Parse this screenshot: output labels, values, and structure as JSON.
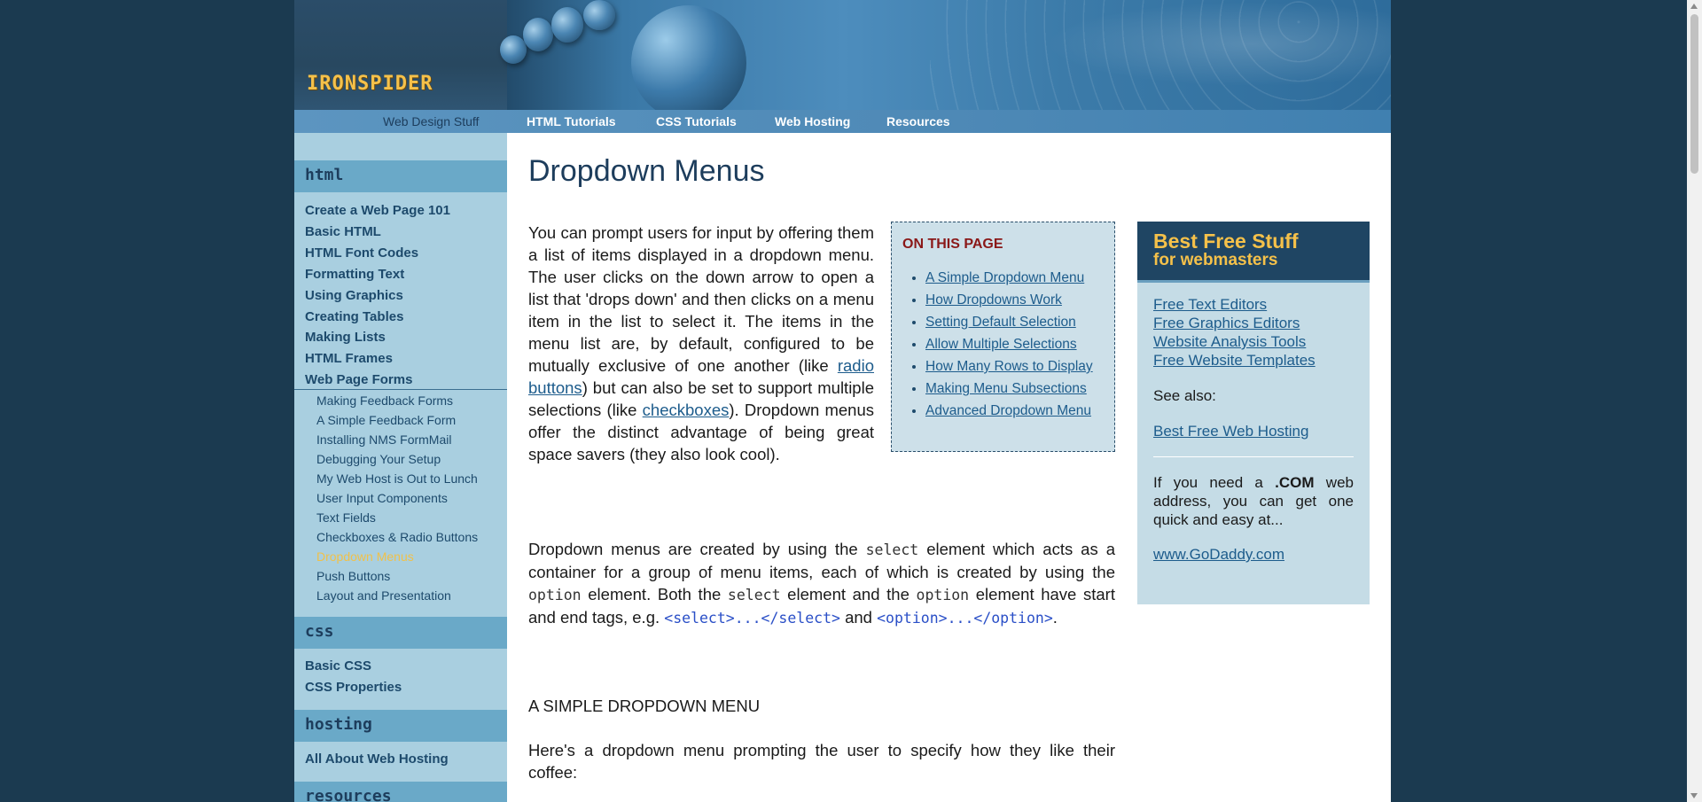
{
  "header": {
    "logo": "IRONSPIDER",
    "site_label": "Web Design Stuff",
    "nav": [
      "HTML Tutorials",
      "CSS Tutorials",
      "Web Hosting",
      "Resources"
    ]
  },
  "sidebar": {
    "sections": [
      {
        "heading": "html"
      },
      {
        "heading": "css"
      },
      {
        "heading": "hosting"
      },
      {
        "heading": "resources"
      }
    ],
    "html_links": [
      "Create a Web Page 101",
      "Basic HTML",
      "HTML Font Codes",
      "Formatting Text",
      "Using Graphics",
      "Creating Tables",
      "Making Lists",
      "HTML Frames",
      "Web Page Forms"
    ],
    "form_sublinks": [
      "Making Feedback Forms",
      "A Simple Feedback Form",
      "Installing NMS FormMail",
      "Debugging Your Setup",
      "My Web Host is Out to Lunch",
      "User Input Components",
      "Text Fields",
      "Checkboxes & Radio Buttons",
      "Dropdown Menus",
      "Push Buttons",
      "Layout and Presentation"
    ],
    "active_sublink": "Dropdown Menus",
    "css_links": [
      "Basic CSS",
      "CSS Properties"
    ],
    "hosting_links": [
      "All About Web Hosting"
    ]
  },
  "main": {
    "title": "Dropdown Menus",
    "intro_1": "You can prompt users for input by offering them a list of items displayed in a dropdown menu. The user clicks on the down arrow to open a list that 'drops down' and then clicks on a menu item in the list to select it. The items in the menu list are, by default, configured to be mutually exclusive of one another (like ",
    "intro_link_1": "radio buttons",
    "intro_2": ") but can also be set to support multiple selections (like ",
    "intro_link_2": "checkboxes",
    "intro_3": "). Dropdown menus offer the distinct advantage of being great space savers (they also look cool).",
    "p2_a": "Dropdown menus are created by using the ",
    "p2_code1": "select",
    "p2_b": " element which acts as a container for a group of menu items, each of which is created by using the ",
    "p2_code2": "option",
    "p2_c": " element. Both the ",
    "p2_code3": "select",
    "p2_d": " element and the ",
    "p2_code4": "option",
    "p2_e": " element have start and end tags, e.g. ",
    "p2_code5": "<select>...</select>",
    "p2_f": " and ",
    "p2_code6": "<option>...</option>",
    "p2_g": ".",
    "section_heading": "A SIMPLE DROPDOWN MENU",
    "p3": "Here's a dropdown menu prompting the user to specify how they like their coffee:"
  },
  "on_this_page": {
    "title": "ON THIS PAGE",
    "items": [
      "A Simple Dropdown Menu",
      "How Dropdowns Work",
      "Setting Default Selection",
      "Allow Multiple Selections",
      "How Many Rows to Display",
      "Making Menu Subsections",
      "Advanced Dropdown Menu"
    ]
  },
  "right_box": {
    "title_1": "Best Free Stuff",
    "title_2": "for webmasters",
    "links": [
      "Free Text Editors",
      "Free Graphics Editors",
      "Website Analysis Tools",
      "Free Website Templates"
    ],
    "see_also": "See also:",
    "see_also_link": "Best Free Web Hosting",
    "com_text_1": "If you need a ",
    "com_bold": ".COM",
    "com_text_2": " web address, you can get one quick and easy at...",
    "com_link": "www.GoDaddy.com "
  },
  "colors": {
    "background": "#1b3a50",
    "sidebar": "#a9cfe0",
    "accent_gold": "#f5c14a",
    "link": "#1d5c8c",
    "title": "#1d3d5c"
  }
}
